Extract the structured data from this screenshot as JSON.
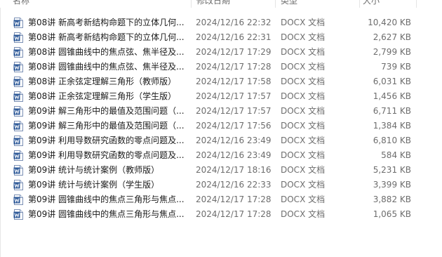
{
  "columns": {
    "name": "名称",
    "modified": "修改日期",
    "type": "类型",
    "size": "大小"
  },
  "colors": {
    "word_icon_blue": "#2b5797",
    "secondary_text": "#6d6d6d"
  },
  "files": [
    {
      "icon": "word-doc-icon",
      "name": "第08讲 新高考新结构命题下的立体几何...",
      "modified": "2024/12/16 22:32",
      "type": "DOCX 文档",
      "size": "10,420 KB"
    },
    {
      "icon": "word-doc-icon",
      "name": "第08讲 新高考新结构命题下的立体几何...",
      "modified": "2024/12/16 22:31",
      "type": "DOCX 文档",
      "size": "2,627 KB"
    },
    {
      "icon": "word-doc-icon",
      "name": "第08讲 圆锥曲线中的焦点弦、焦半径及...",
      "modified": "2024/12/17 17:29",
      "type": "DOCX 文档",
      "size": "2,799 KB"
    },
    {
      "icon": "word-doc-icon",
      "name": "第08讲 圆锥曲线中的焦点弦、焦半径及...",
      "modified": "2024/12/17 17:28",
      "type": "DOCX 文档",
      "size": "739 KB"
    },
    {
      "icon": "word-doc-icon",
      "name": "第08讲 正余弦定理解三角形（教师版）",
      "modified": "2024/12/17 17:58",
      "type": "DOCX 文档",
      "size": "6,031 KB"
    },
    {
      "icon": "word-doc-icon",
      "name": "第08讲 正余弦定理解三角形（学生版）",
      "modified": "2024/12/17 17:57",
      "type": "DOCX 文档",
      "size": "1,456 KB"
    },
    {
      "icon": "word-doc-icon",
      "name": "第09讲 解三角形中的最值及范围问题（...",
      "modified": "2024/12/17 17:57",
      "type": "DOCX 文档",
      "size": "6,711 KB"
    },
    {
      "icon": "word-doc-icon",
      "name": "第09讲 解三角形中的最值及范围问题（...",
      "modified": "2024/12/17 17:56",
      "type": "DOCX 文档",
      "size": "1,384 KB"
    },
    {
      "icon": "word-doc-icon",
      "name": "第09讲 利用导数研究函数的零点问题及...",
      "modified": "2024/12/16 23:49",
      "type": "DOCX 文档",
      "size": "6,810 KB"
    },
    {
      "icon": "word-doc-icon",
      "name": "第09讲 利用导数研究函数的零点问题及...",
      "modified": "2024/12/16 23:49",
      "type": "DOCX 文档",
      "size": "584 KB"
    },
    {
      "icon": "word-doc-icon",
      "name": "第09讲 统计与统计案例（教师版）",
      "modified": "2024/12/17 18:16",
      "type": "DOCX 文档",
      "size": "5,231 KB"
    },
    {
      "icon": "word-doc-icon",
      "name": "第09讲 统计与统计案例（学生版）",
      "modified": "2024/12/16 22:33",
      "type": "DOCX 文档",
      "size": "3,399 KB"
    },
    {
      "icon": "word-doc-icon",
      "name": "第09讲 圆锥曲线中的焦点三角形与焦点...",
      "modified": "2024/12/17 17:28",
      "type": "DOCX 文档",
      "size": "3,882 KB"
    },
    {
      "icon": "word-doc-icon",
      "name": "第09讲 圆锥曲线中的焦点三角形与焦点...",
      "modified": "2024/12/17 17:28",
      "type": "DOCX 文档",
      "size": "1,065 KB"
    }
  ]
}
